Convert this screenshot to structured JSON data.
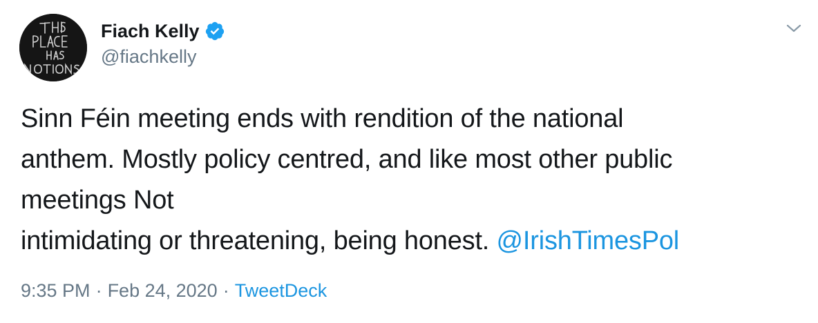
{
  "user": {
    "display_name": "Fiach Kelly",
    "handle": "@fiachkelly",
    "verified": true,
    "avatar_text": [
      "THIS",
      "PLACE",
      "HAS",
      "NOTIONS"
    ]
  },
  "tweet": {
    "lines": [
      "Sinn Féin meeting ends with rendition of the national",
      "anthem. Mostly policy centred, and like most other public",
      "meetings Not",
      "intimidating or threatening, being honest. "
    ],
    "mention": "@IrishTimesPol"
  },
  "meta": {
    "time": "9:35 PM",
    "separator": "·",
    "date": "Feb 24, 2020",
    "source": "TweetDeck"
  },
  "icons": {
    "verified": "verified-badge-icon",
    "menu": "chevron-down-icon"
  },
  "colors": {
    "link": "#1b95e0",
    "secondary_text": "#657786",
    "primary_text": "#14171a",
    "verified": "#1da1f2"
  }
}
